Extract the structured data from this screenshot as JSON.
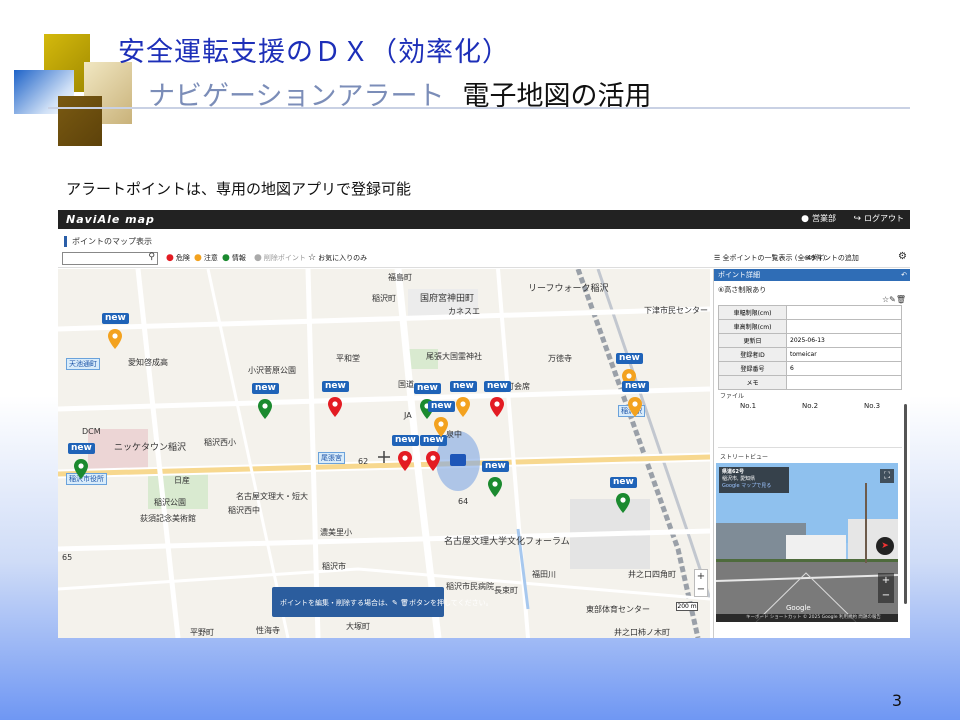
{
  "slide": {
    "title": "安全運転支援のＤＸ（効率化）",
    "subtitle_part1": "ナビゲーションアラート",
    "subtitle_part2": "電子地図の活用",
    "caption": "アラートポイントは、専用の地図アプリで登録可能",
    "page_number": "3"
  },
  "app": {
    "logo": "NaviAle map",
    "user": "営業部",
    "logout": "ログアウト",
    "section_label": "ポイントのマップ表示",
    "search": {
      "value": "",
      "placeholder": ""
    },
    "legend": {
      "danger": "危険",
      "caution": "注意",
      "info": "情報",
      "disabled": "削除ポイント",
      "favorites": "お気に入りのみ"
    },
    "show_all": "全ポイントの一覧表示 (全 49件)",
    "add_point": "ポイントの追加",
    "tooltip_prefix": "ポイントを編集・削除する場合は、",
    "tooltip_suffix": "ボタンを押してください。",
    "scale_label": "200 m",
    "badge": "new"
  },
  "map_labels": [
    "福島町",
    "稲沢町",
    "国府宮神田町",
    "リーフウォーク稲沢",
    "カネスエ",
    "下津市民センター",
    "愛知啓成高",
    "平和堂",
    "尾張大国霊神社",
    "万徳寺",
    "小沢菅原公園",
    "本町会席",
    "天池通町",
    "DCM",
    "ニッケタウン稲沢",
    "稲沢西小",
    "稲沢市役所",
    "日産",
    "稲沢公園",
    "名古屋文理大・短大",
    "稲沢西中",
    "荻須記念美術館",
    "JA",
    "泉中",
    "国道",
    "尾張宮",
    "名古屋文理大学文化フォーラム",
    "濃美里小",
    "稲沢市",
    "稲沢市民病院",
    "長束町",
    "東部体育センター",
    "井之口四角町",
    "大塚町",
    "井之口柿ノ木町",
    "平野町",
    "性海寺",
    "64",
    "福田川",
    "62",
    "65",
    "稲沢駅"
  ],
  "panel": {
    "header": "ポイント詳細",
    "type": "⑥高さ制限あり",
    "rows": [
      {
        "key": "車幅制限(cm)",
        "value": ""
      },
      {
        "key": "車高制限(cm)",
        "value": ""
      },
      {
        "key": "更新日",
        "value": "2025-06-13"
      },
      {
        "key": "登録者ID",
        "value": "tomeicar"
      },
      {
        "key": "登録番号",
        "value": "6"
      },
      {
        "key": "メモ",
        "value": ""
      }
    ],
    "files_label": "ファイル",
    "files": [
      "No.1",
      "No.2",
      "No.3"
    ],
    "streetview_label": "ストリートビュー",
    "sv_title": "県道62号",
    "sv_line2": "稲沢市, 愛知県",
    "sv_line3": "Google マップで見る",
    "sv_footer": "キーボード ショートカット   © 2025 Google   利用規約   問題の報告",
    "sv_google": "Google"
  },
  "colors": {
    "title": "#1d2fb8",
    "pin_danger": "#e31c23",
    "pin_caution": "#f3a21f",
    "pin_info": "#1b8a2f",
    "badge": "#1f63b8",
    "panel_header": "#2f6db6"
  }
}
